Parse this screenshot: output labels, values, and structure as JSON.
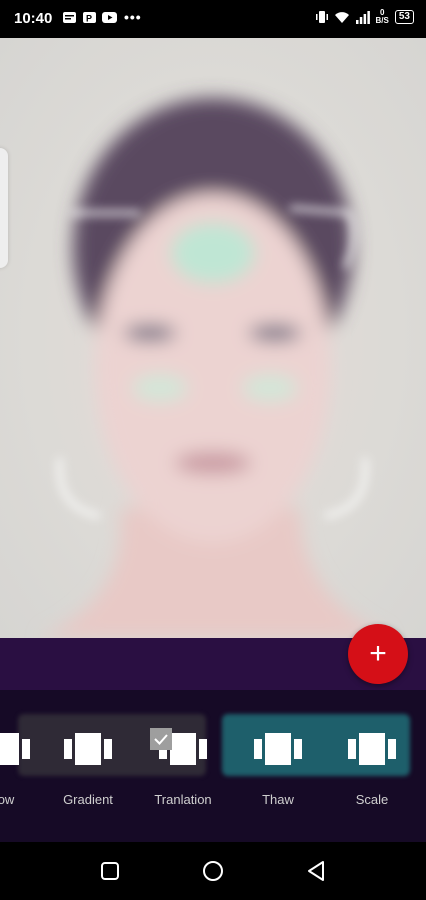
{
  "status_bar": {
    "time": "10:40",
    "more": "•••",
    "speed_value": "0",
    "speed_unit": "B/S",
    "battery": "53"
  },
  "toolbar": {
    "items": [
      {
        "label": "ow",
        "icon": "transition-icon"
      },
      {
        "label": "Gradient",
        "icon": "transition-icon"
      },
      {
        "label": "Tranlation",
        "icon": "transition-icon",
        "selected": true
      },
      {
        "label": "Thaw",
        "icon": "transition-icon"
      },
      {
        "label": "Scale",
        "icon": "transition-icon"
      }
    ]
  },
  "fab": {
    "label": "+"
  },
  "colors": {
    "accent": "#d50f17",
    "ad_bar": "#2a0f42",
    "toolbar": "#160a26",
    "teal": "#1e5f6b"
  }
}
